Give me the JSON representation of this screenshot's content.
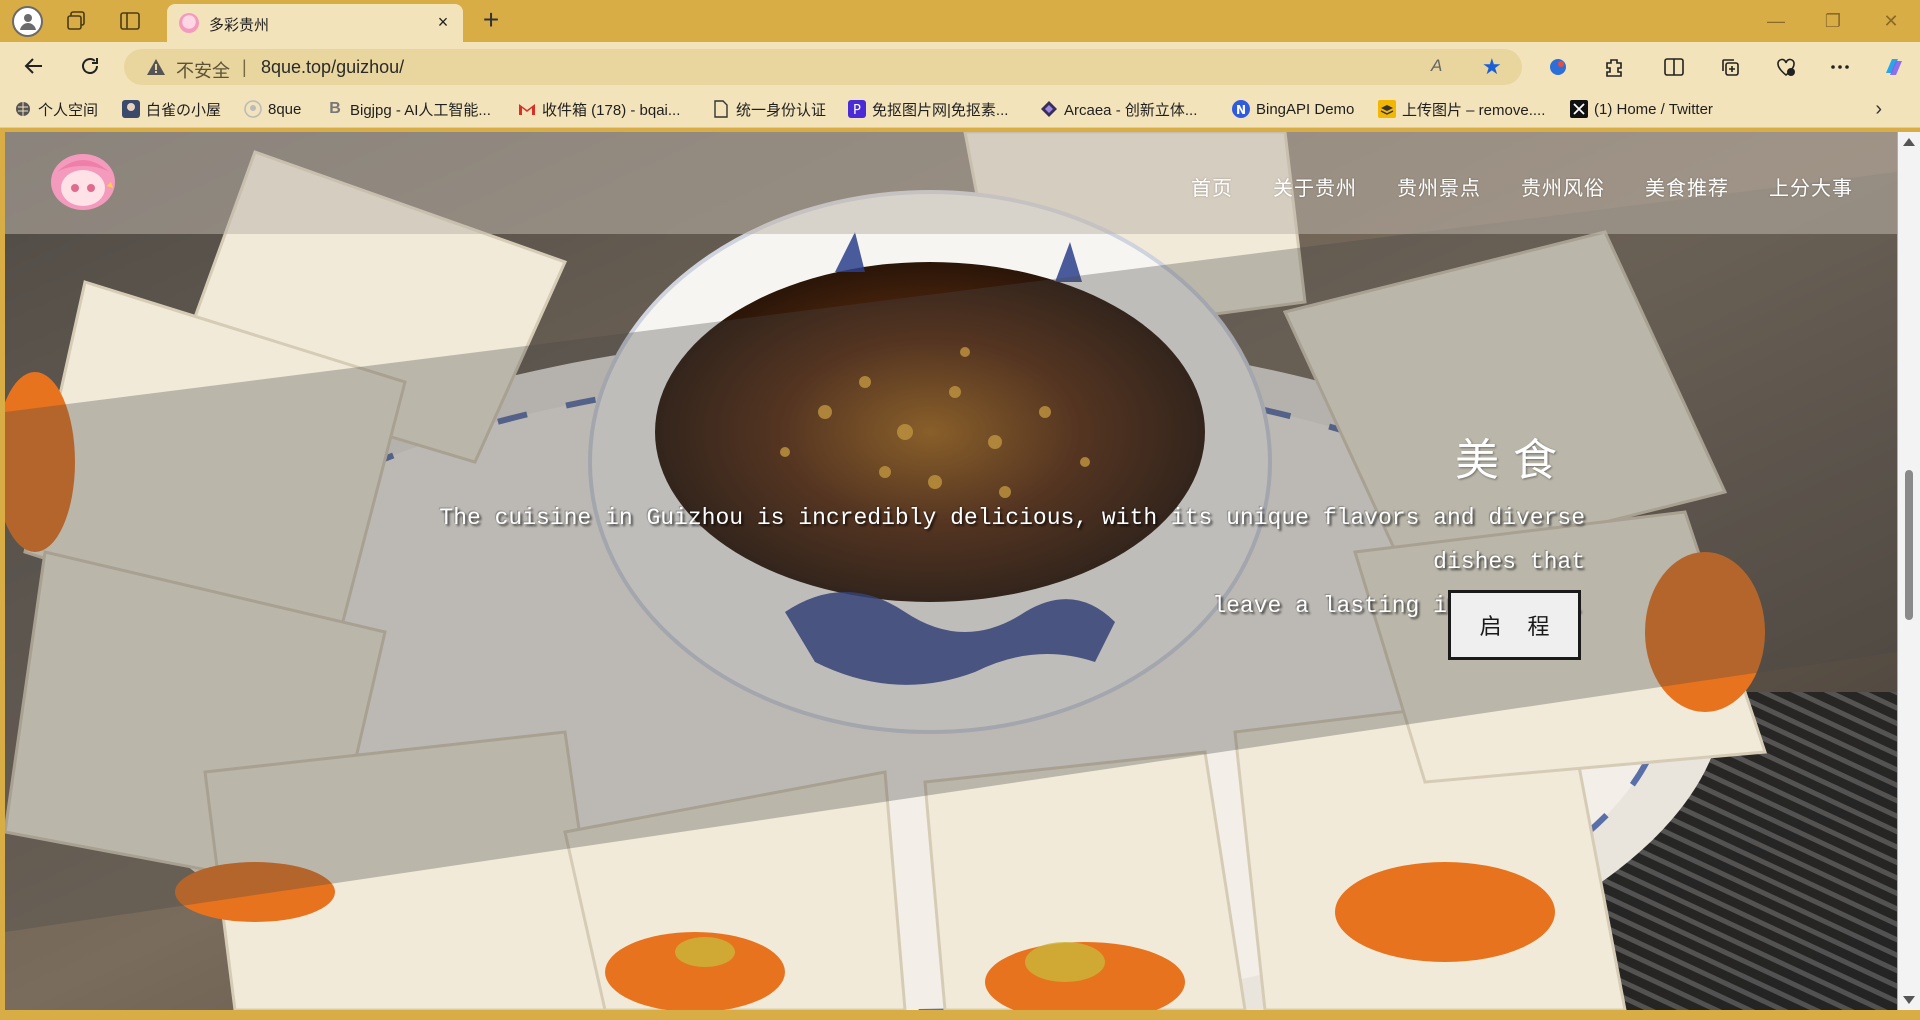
{
  "browser": {
    "tab_title": "多彩贵州",
    "tab_close": "×",
    "new_tab": "+",
    "address": {
      "security_label": "不安全",
      "separator": "|",
      "url": "8que.top/guizhou/",
      "read_aloud": "A"
    },
    "window_controls": {
      "minimize": "—",
      "restore": "❐",
      "close": "✕"
    },
    "bookmarks": [
      {
        "label": "个人空间",
        "icon": "globe-icon"
      },
      {
        "label": "白雀の小屋",
        "icon": "avatar-icon"
      },
      {
        "label": "8que",
        "icon": "github-icon"
      },
      {
        "label": "Bigjpg - AI人工智能...",
        "icon": "b-letter-icon"
      },
      {
        "label": "收件箱 (178) - bqai...",
        "icon": "gmail-icon"
      },
      {
        "label": "统一身份认证",
        "icon": "document-icon"
      },
      {
        "label": "免抠图片网|免抠素...",
        "icon": "p-logo-icon"
      },
      {
        "label": "Arcaea - 创新立体...",
        "icon": "diamond-icon"
      },
      {
        "label": "BingAPI Demo",
        "icon": "n-logo-icon"
      },
      {
        "label": "上传图片 – remove....",
        "icon": "layers-icon"
      },
      {
        "label": "(1) Home / Twitter",
        "icon": "x-logo-icon"
      }
    ],
    "bookmarks_more": "›"
  },
  "site": {
    "nav": [
      "首页",
      "关于贵州",
      "贵州景点",
      "贵州风俗",
      "美食推荐",
      "上分大事"
    ],
    "hero": {
      "title": "美食",
      "text_line1": "The cuisine in Guizhou is incredibly delicious, with its unique flavors and diverse dishes that",
      "text_line2": "leave a lasting impression.",
      "button": "启程"
    }
  },
  "colors": {
    "chrome_title": "#d9ad45",
    "chrome_toolbar": "#f3e3bb",
    "star_accent": "#1b5fd6"
  }
}
